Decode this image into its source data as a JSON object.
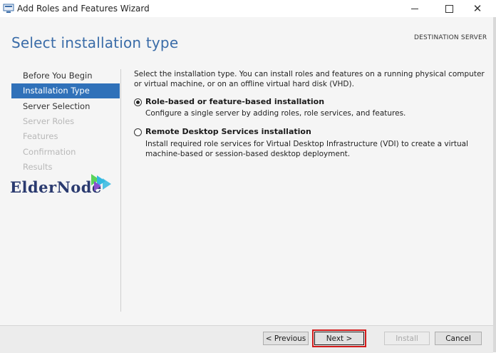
{
  "window": {
    "title": "Add Roles and Features Wizard",
    "icon": "server-manager-icon"
  },
  "header": {
    "page_title": "Select installation type",
    "destination_label": "DESTINATION SERVER"
  },
  "nav": {
    "items": [
      {
        "label": "Before You Begin",
        "state": "enabled"
      },
      {
        "label": "Installation Type",
        "state": "active"
      },
      {
        "label": "Server Selection",
        "state": "enabled"
      },
      {
        "label": "Server Roles",
        "state": "disabled"
      },
      {
        "label": "Features",
        "state": "disabled"
      },
      {
        "label": "Confirmation",
        "state": "disabled"
      },
      {
        "label": "Results",
        "state": "disabled"
      }
    ]
  },
  "watermark": {
    "text": "eldernode",
    "colors": [
      "#2a3a6f",
      "#33b8e0",
      "#5ad35a",
      "#8a4fd0"
    ]
  },
  "main": {
    "description": "Select the installation type. You can install roles and features on a running physical computer or virtual machine, or on an offline virtual hard disk (VHD).",
    "options": [
      {
        "title": "Role-based or feature-based installation",
        "description": "Configure a single server by adding roles, role services, and features.",
        "selected": true
      },
      {
        "title": "Remote Desktop Services installation",
        "description": "Install required role services for Virtual Desktop Infrastructure (VDI) to create a virtual machine-based or session-based desktop deployment.",
        "selected": false
      }
    ]
  },
  "footer": {
    "previous_label": "< Previous",
    "next_label": "Next >",
    "install_label": "Install",
    "cancel_label": "Cancel",
    "highlight_color": "#d21a1a"
  }
}
